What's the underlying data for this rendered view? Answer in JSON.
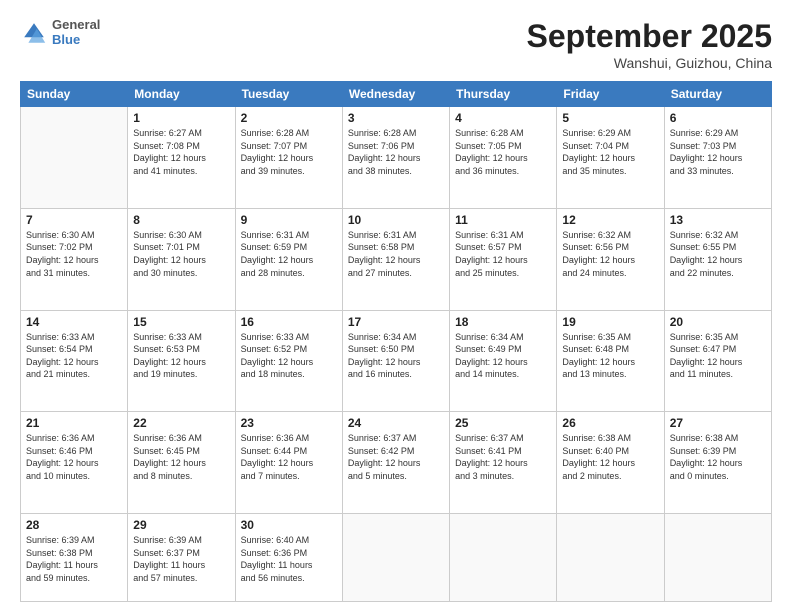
{
  "header": {
    "logo_general": "General",
    "logo_blue": "Blue",
    "month": "September 2025",
    "location": "Wanshui, Guizhou, China"
  },
  "weekdays": [
    "Sunday",
    "Monday",
    "Tuesday",
    "Wednesday",
    "Thursday",
    "Friday",
    "Saturday"
  ],
  "weeks": [
    [
      {
        "day": "",
        "info": ""
      },
      {
        "day": "1",
        "info": "Sunrise: 6:27 AM\nSunset: 7:08 PM\nDaylight: 12 hours\nand 41 minutes."
      },
      {
        "day": "2",
        "info": "Sunrise: 6:28 AM\nSunset: 7:07 PM\nDaylight: 12 hours\nand 39 minutes."
      },
      {
        "day": "3",
        "info": "Sunrise: 6:28 AM\nSunset: 7:06 PM\nDaylight: 12 hours\nand 38 minutes."
      },
      {
        "day": "4",
        "info": "Sunrise: 6:28 AM\nSunset: 7:05 PM\nDaylight: 12 hours\nand 36 minutes."
      },
      {
        "day": "5",
        "info": "Sunrise: 6:29 AM\nSunset: 7:04 PM\nDaylight: 12 hours\nand 35 minutes."
      },
      {
        "day": "6",
        "info": "Sunrise: 6:29 AM\nSunset: 7:03 PM\nDaylight: 12 hours\nand 33 minutes."
      }
    ],
    [
      {
        "day": "7",
        "info": "Sunrise: 6:30 AM\nSunset: 7:02 PM\nDaylight: 12 hours\nand 31 minutes."
      },
      {
        "day": "8",
        "info": "Sunrise: 6:30 AM\nSunset: 7:01 PM\nDaylight: 12 hours\nand 30 minutes."
      },
      {
        "day": "9",
        "info": "Sunrise: 6:31 AM\nSunset: 6:59 PM\nDaylight: 12 hours\nand 28 minutes."
      },
      {
        "day": "10",
        "info": "Sunrise: 6:31 AM\nSunset: 6:58 PM\nDaylight: 12 hours\nand 27 minutes."
      },
      {
        "day": "11",
        "info": "Sunrise: 6:31 AM\nSunset: 6:57 PM\nDaylight: 12 hours\nand 25 minutes."
      },
      {
        "day": "12",
        "info": "Sunrise: 6:32 AM\nSunset: 6:56 PM\nDaylight: 12 hours\nand 24 minutes."
      },
      {
        "day": "13",
        "info": "Sunrise: 6:32 AM\nSunset: 6:55 PM\nDaylight: 12 hours\nand 22 minutes."
      }
    ],
    [
      {
        "day": "14",
        "info": "Sunrise: 6:33 AM\nSunset: 6:54 PM\nDaylight: 12 hours\nand 21 minutes."
      },
      {
        "day": "15",
        "info": "Sunrise: 6:33 AM\nSunset: 6:53 PM\nDaylight: 12 hours\nand 19 minutes."
      },
      {
        "day": "16",
        "info": "Sunrise: 6:33 AM\nSunset: 6:52 PM\nDaylight: 12 hours\nand 18 minutes."
      },
      {
        "day": "17",
        "info": "Sunrise: 6:34 AM\nSunset: 6:50 PM\nDaylight: 12 hours\nand 16 minutes."
      },
      {
        "day": "18",
        "info": "Sunrise: 6:34 AM\nSunset: 6:49 PM\nDaylight: 12 hours\nand 14 minutes."
      },
      {
        "day": "19",
        "info": "Sunrise: 6:35 AM\nSunset: 6:48 PM\nDaylight: 12 hours\nand 13 minutes."
      },
      {
        "day": "20",
        "info": "Sunrise: 6:35 AM\nSunset: 6:47 PM\nDaylight: 12 hours\nand 11 minutes."
      }
    ],
    [
      {
        "day": "21",
        "info": "Sunrise: 6:36 AM\nSunset: 6:46 PM\nDaylight: 12 hours\nand 10 minutes."
      },
      {
        "day": "22",
        "info": "Sunrise: 6:36 AM\nSunset: 6:45 PM\nDaylight: 12 hours\nand 8 minutes."
      },
      {
        "day": "23",
        "info": "Sunrise: 6:36 AM\nSunset: 6:44 PM\nDaylight: 12 hours\nand 7 minutes."
      },
      {
        "day": "24",
        "info": "Sunrise: 6:37 AM\nSunset: 6:42 PM\nDaylight: 12 hours\nand 5 minutes."
      },
      {
        "day": "25",
        "info": "Sunrise: 6:37 AM\nSunset: 6:41 PM\nDaylight: 12 hours\nand 3 minutes."
      },
      {
        "day": "26",
        "info": "Sunrise: 6:38 AM\nSunset: 6:40 PM\nDaylight: 12 hours\nand 2 minutes."
      },
      {
        "day": "27",
        "info": "Sunrise: 6:38 AM\nSunset: 6:39 PM\nDaylight: 12 hours\nand 0 minutes."
      }
    ],
    [
      {
        "day": "28",
        "info": "Sunrise: 6:39 AM\nSunset: 6:38 PM\nDaylight: 11 hours\nand 59 minutes."
      },
      {
        "day": "29",
        "info": "Sunrise: 6:39 AM\nSunset: 6:37 PM\nDaylight: 11 hours\nand 57 minutes."
      },
      {
        "day": "30",
        "info": "Sunrise: 6:40 AM\nSunset: 6:36 PM\nDaylight: 11 hours\nand 56 minutes."
      },
      {
        "day": "",
        "info": ""
      },
      {
        "day": "",
        "info": ""
      },
      {
        "day": "",
        "info": ""
      },
      {
        "day": "",
        "info": ""
      }
    ]
  ]
}
